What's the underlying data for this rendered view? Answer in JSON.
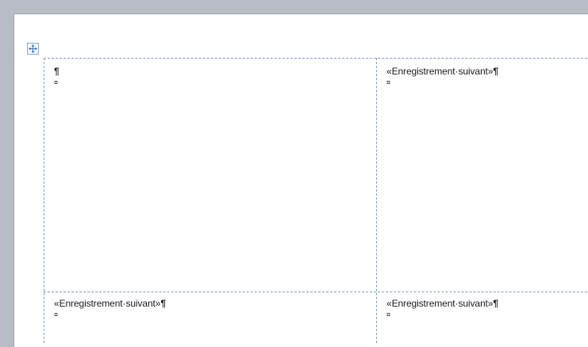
{
  "document": {
    "table": {
      "move_handle_icon": "four-way-arrow",
      "cells": [
        {
          "text": "",
          "pilcrow": "¶",
          "end_mark": "¤"
        },
        {
          "text": "«Enregistrement·suivant»",
          "pilcrow": "¶",
          "end_mark": "¤"
        },
        {
          "text": "«Enregistrement·suivant»",
          "pilcrow": "¶",
          "end_mark": "¤"
        },
        {
          "text": "«Enregistrement·suivant»",
          "pilcrow": "¶",
          "end_mark": "¤"
        }
      ]
    },
    "colors": {
      "gridline": "#7f9fc8",
      "page": "#ffffff",
      "background": "#b8bcc4"
    }
  }
}
